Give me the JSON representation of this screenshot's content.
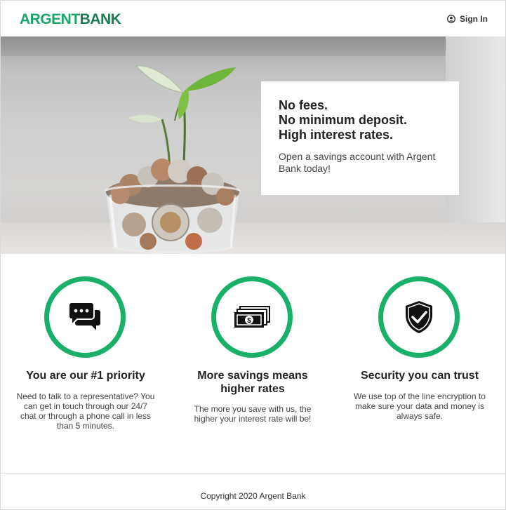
{
  "header": {
    "logo_part1": "ARGENT",
    "logo_part2": "BANK",
    "signin_label": "Sign In",
    "user_icon": "user-circle-icon"
  },
  "hero": {
    "image": "plant-in-coin-jar",
    "headline": [
      "No fees.",
      "No minimum deposit.",
      "High interest rates."
    ],
    "subtext": "Open a savings account with Argent Bank today!"
  },
  "features": [
    {
      "icon": "chat-bubbles-icon",
      "title": "You are our #1 priority",
      "text": "Need to talk to a representative? You can get in touch through our 24/7 chat or through a phone call in less than 5 minutes."
    },
    {
      "icon": "money-bills-icon",
      "title": "More savings means higher rates",
      "text": "The more you save with us, the higher your interest rate will be!"
    },
    {
      "icon": "shield-check-icon",
      "title": "Security you can trust",
      "text": "We use top of the line encryption to make sure your data and money is always safe."
    }
  ],
  "footer": {
    "copyright": "Copyright 2020 Argent Bank"
  },
  "colors": {
    "brand_green": "#19b06a",
    "brand_dark_green": "#1b7d53"
  }
}
